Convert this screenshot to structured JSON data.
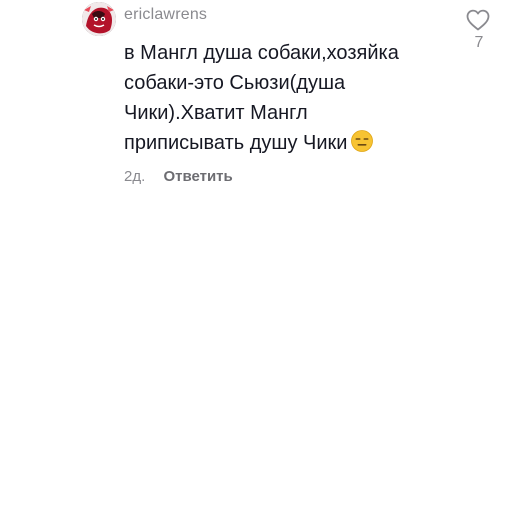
{
  "comment": {
    "username": "ericlawrens",
    "text_lines": [
      "в Мангл душа собаки,хозяйка",
      "собаки-это Сьюзи(душа",
      "Чики).Хватит Мангл",
      "приписывать душу Чики"
    ],
    "emoji": "expressionless-face",
    "time": "2д.",
    "reply_label": "Ответить",
    "like_count": "7",
    "like_icon": "heart-outline-icon"
  },
  "colors": {
    "text": "#161823",
    "secondary": "#8a8a8f",
    "emoji_face": "#f7c332"
  }
}
